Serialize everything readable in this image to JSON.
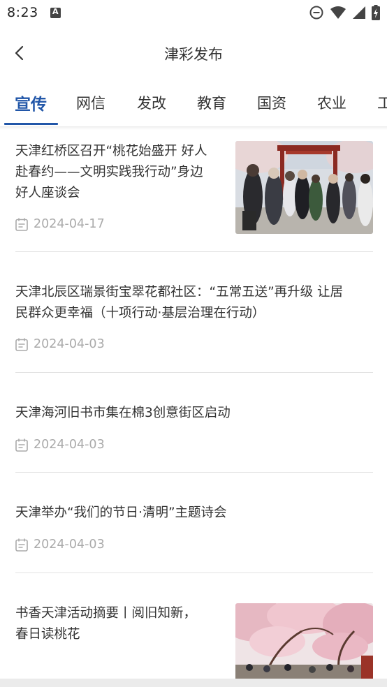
{
  "status": {
    "time": "8:23"
  },
  "header": {
    "title": "津彩发布"
  },
  "tabs": [
    {
      "label": "宣传",
      "active": true
    },
    {
      "label": "网信",
      "active": false
    },
    {
      "label": "发改",
      "active": false
    },
    {
      "label": "教育",
      "active": false
    },
    {
      "label": "国资",
      "active": false
    },
    {
      "label": "农业",
      "active": false
    },
    {
      "label": "工",
      "active": false
    }
  ],
  "news": [
    {
      "title_lines": [
        "天津红桥区召开“桃花始盛开 好人",
        "赴春约——文明实践我行动”身边",
        "好人座谈会"
      ],
      "date": "2024-04-17",
      "has_image": true
    },
    {
      "title_lines": [
        "天津北辰区瑞景街宝翠花都社区：“五常五送”再升级 让居",
        "民群众更幸福（十项行动·基层治理在行动）"
      ],
      "date": "2024-04-03",
      "has_image": false
    },
    {
      "title_lines": [
        "天津海河旧书市集在棉3创意街区启动"
      ],
      "date": "2024-04-03",
      "has_image": false
    },
    {
      "title_lines": [
        "天津举办“我们的节日·清明”主题诗会"
      ],
      "date": "2024-04-03",
      "has_image": false
    },
    {
      "title_lines": [
        "书香天津活动摘要丨阅旧知新，",
        "春日读桃花"
      ],
      "date": "",
      "has_image": true
    }
  ],
  "colors": {
    "accent": "#2156a8",
    "meta": "#aaaaaa",
    "divider": "#e2e2e2"
  }
}
